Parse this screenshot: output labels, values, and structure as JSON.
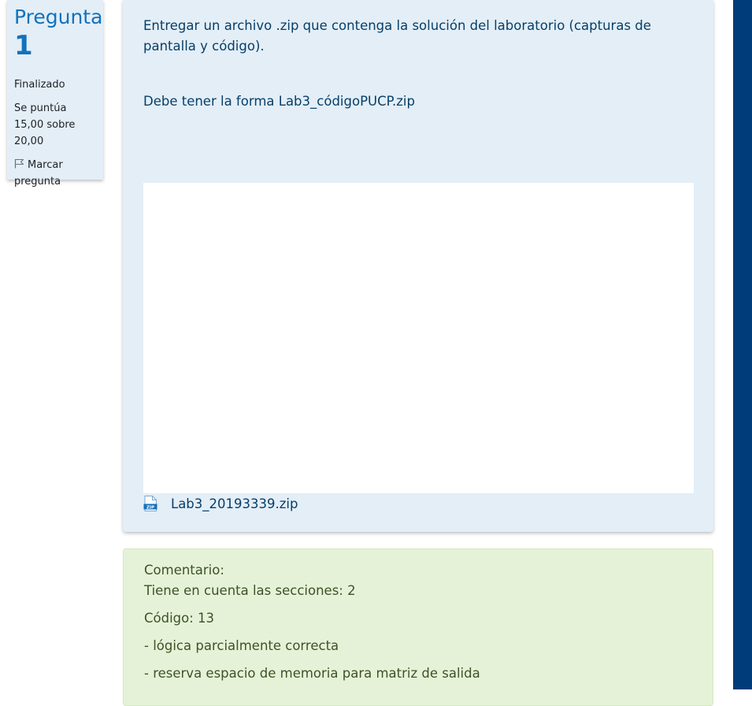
{
  "question": {
    "label": "Pregunta",
    "number": "1",
    "state": "Finalizado",
    "grade": "Se puntúa 15,00 sobre 20,00",
    "flag_label": "Marcar pregunta"
  },
  "content": {
    "paragraphs": [
      "Entregar un archivo .zip que contenga la solución del laboratorio (capturas de pantalla y código).",
      "Debe tener la forma Lab3_códigoPUCP.zip"
    ],
    "attachment_name": "Lab3_20193339.zip"
  },
  "feedback": {
    "heading": "Comentario:",
    "lines": [
      "Tiene en cuenta las secciones: 2",
      "Código: 13",
      "- lógica parcialmente correcta",
      "- reserva espacio de memoria para matriz de salida"
    ]
  },
  "colors": {
    "question_blue": "#1272bb",
    "panel_bg": "#e3eef7",
    "feedback_bg": "#e6f2d8",
    "sidebar_navy": "#003b7a"
  },
  "icons": {
    "flag": "flag-icon",
    "attachment": "zip-file-icon"
  }
}
